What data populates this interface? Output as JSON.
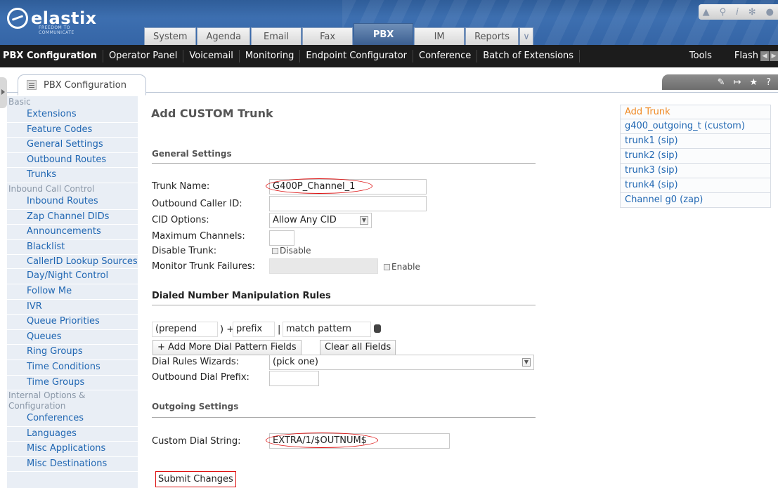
{
  "header": {
    "brand": "elastix",
    "tagline": "FREEDOM TO COMMUNICATE",
    "tabs": [
      "System",
      "Agenda",
      "Email",
      "Fax",
      "PBX",
      "IM",
      "Reports"
    ],
    "active_tab": "PBX",
    "more_tab_glyph": "∨"
  },
  "subnav": {
    "items": [
      "PBX Configuration",
      "Operator Panel",
      "Voicemail",
      "Monitoring",
      "Endpoint Configurator",
      "Conference",
      "Batch of Extensions",
      "Tools",
      "Flash"
    ],
    "active": "PBX Configuration"
  },
  "breadcrumb": {
    "tab_label": "PBX Configuration"
  },
  "sidebar": {
    "basic_header": "Basic",
    "basic_items": [
      "Extensions",
      "Feature Codes",
      "General Settings",
      "Outbound Routes",
      "Trunks"
    ],
    "inbound_header": "Inbound Call Control",
    "inbound_items": [
      "Inbound Routes",
      "Zap Channel DIDs",
      "Announcements",
      "Blacklist",
      "CallerID Lookup Sources",
      "Day/Night Control",
      "Follow Me",
      "IVR",
      "Queue Priorities",
      "Queues",
      "Ring Groups",
      "Time Conditions",
      "Time Groups"
    ],
    "internal_header": "Internal Options & Configuration",
    "internal_items": [
      "Conferences",
      "Languages",
      "Misc Applications",
      "Misc Destinations"
    ]
  },
  "form": {
    "title": "Add CUSTOM Trunk",
    "general_settings": "General Settings",
    "trunk_name_label": "Trunk Name:",
    "trunk_name_value": "G400P_Channel_1",
    "outbound_cid_label": "Outbound Caller ID:",
    "outbound_cid_value": "",
    "cid_options_label": "CID Options:",
    "cid_options_value": "Allow Any CID",
    "max_channels_label": "Maximum Channels:",
    "max_channels_value": "",
    "disable_trunk_label": "Disable Trunk:",
    "disable_checkbox_label": "Disable",
    "monitor_label": "Monitor Trunk Failures:",
    "monitor_value": "",
    "enable_checkbox_label": "Enable",
    "dial_rules_section": "Dialed Number Manipulation Rules",
    "prepend_placeholder": "(prepend",
    "prepend_suffix": ") +",
    "prefix_placeholder": "prefix",
    "pipe": "|",
    "match_placeholder": "match pattern",
    "add_more_button": "+ Add More Dial Pattern Fields",
    "clear_all_button": "Clear all Fields",
    "dial_wizards_label": "Dial Rules Wizards:",
    "dial_wizards_value": "(pick one)",
    "outbound_prefix_label": "Outbound Dial Prefix:",
    "outbound_prefix_value": "",
    "outgoing_settings": "Outgoing Settings",
    "custom_dial_label": "Custom Dial String:",
    "custom_dial_value": "EXTRA/1/$OUTNUM$",
    "submit_button": "Submit Changes"
  },
  "trunks": [
    "Add Trunk",
    "g400_outgoing_t (custom)",
    "trunk1 (sip)",
    "trunk2 (sip)",
    "trunk3 (sip)",
    "trunk4 (sip)",
    "Channel g0 (zap)"
  ],
  "tool_icons": [
    "edit-icon",
    "arrow-icon",
    "star-icon",
    "help-icon"
  ],
  "colors": {
    "accent_orange": "#f08a24",
    "link_blue": "#1f66b2",
    "highlight_red": "#dd1111",
    "header_blue": "#3565a6"
  }
}
